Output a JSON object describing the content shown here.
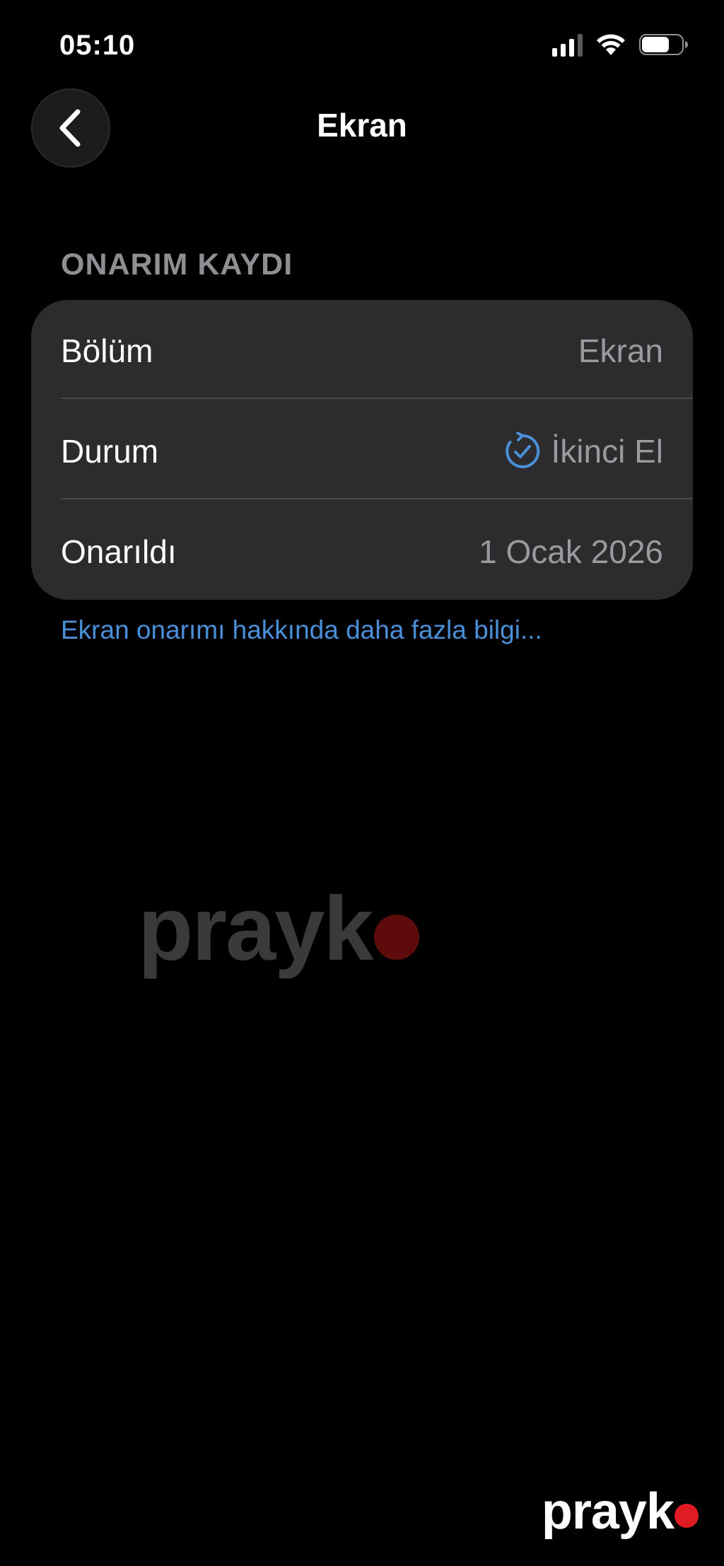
{
  "status_bar": {
    "time": "05:10",
    "icons": [
      "signal-icon",
      "wifi-icon",
      "battery-icon"
    ]
  },
  "nav": {
    "back_icon": "chevron-left-icon",
    "title": "Ekran"
  },
  "section": {
    "header": "ONARIM KAYDI",
    "rows": [
      {
        "label": "Bölüm",
        "value": "Ekran"
      },
      {
        "label": "Durum",
        "value": "İkinci El",
        "icon": "used-part-check-icon"
      },
      {
        "label": "Onarıldı",
        "value": "1 Ocak 2026"
      }
    ]
  },
  "link": {
    "text": "Ekran onarımı hakkında daha fazla bilgi..."
  },
  "watermark": {
    "text": "prayk",
    "dot_color": "#e11b22"
  },
  "colors": {
    "background": "#000000",
    "card": "#2c2c2e",
    "accent_link": "#4a90d9",
    "secondary_text": "#9a9a9f"
  }
}
